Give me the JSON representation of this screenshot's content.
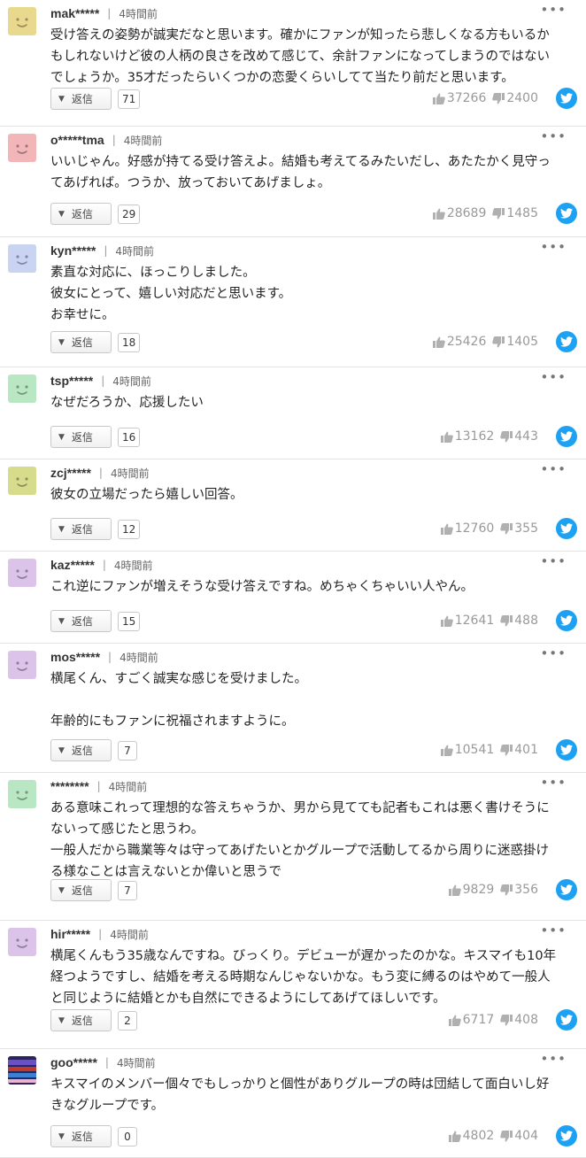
{
  "labels": {
    "reply": "返信",
    "more": "•••"
  },
  "colors": {
    "twitter": "#1da1f2",
    "vote_text": "#999999"
  },
  "comments": [
    {
      "user": "mak*****",
      "time": "4時間前",
      "avatar_color": "#e9d98f",
      "text": "受け答えの姿勢が誠実だなと思います。確かにファンが知ったら悲しくなる方もいるか\nもしれないけど彼の人柄の良さを改めて感じて、余計ファンになってしまうのではない\nでしょうか。35才だったらいくつかの恋愛くらいしてて当たり前だと思います。",
      "replies": "71",
      "likes": "37266",
      "dislikes": "2400"
    },
    {
      "user": "o*****tma",
      "time": "4時間前",
      "avatar_color": "#f2b5b8",
      "text": "いいじゃん。好感が持てる受け答えよ。結婚も考えてるみたいだし、あたたかく見守っ\nてあげれば。つうか、放っておいてあげましょ。",
      "replies": "29",
      "likes": "28689",
      "dislikes": "1485"
    },
    {
      "user": "kyn*****",
      "time": "4時間前",
      "avatar_color": "#c9d4f2",
      "text": "素直な対応に、ほっこりしました。\n彼女にとって、嬉しい対応だと思います。\nお幸せに。",
      "replies": "18",
      "likes": "25426",
      "dislikes": "1405"
    },
    {
      "user": "tsp*****",
      "time": "4時間前",
      "avatar_color": "#b9e6c3",
      "text": "なぜだろうか、応援したい",
      "replies": "16",
      "likes": "13162",
      "dislikes": "443"
    },
    {
      "user": "zcj*****",
      "time": "4時間前",
      "avatar_color": "#d6dc8c",
      "text": "彼女の立場だったら嬉しい回答。",
      "replies": "12",
      "likes": "12760",
      "dislikes": "355"
    },
    {
      "user": "kaz*****",
      "time": "4時間前",
      "avatar_color": "#dcc3ea",
      "text": "これ逆にファンが増えそうな受け答えですね。めちゃくちゃいい人やん。",
      "replies": "15",
      "likes": "12641",
      "dislikes": "488"
    },
    {
      "user": "mos*****",
      "time": "4時間前",
      "avatar_color": "#dcc3ea",
      "text": "横尾くん、すごく誠実な感じを受けました。\n\n年齢的にもファンに祝福されますように。",
      "replies": "7",
      "likes": "10541",
      "dislikes": "401"
    },
    {
      "user": "********",
      "time": "4時間前",
      "avatar_color": "#b9e6c3",
      "text": "ある意味これって理想的な答えちゃうか、男から見てても記者もこれは悪く書けそうに\nないって感じたと思うわ。\n一般人だから職業等々は守ってあげたいとかグループで活動してるから周りに迷惑掛け\nる様なことは言えないとか偉いと思うで",
      "replies": "7",
      "likes": "9829",
      "dislikes": "356"
    },
    {
      "user": "hir*****",
      "time": "4時間前",
      "avatar_color": "#dcc3ea",
      "text": "横尾くんもう35歳なんですね。びっくり。デビューが遅かったのかな。キスマイも10年\n経つようですし、結婚を考える時期なんじゃないかな。もう変に縛るのはやめて一般人\nと同じように結婚とかも自然にできるようにしてあげてほしいです。",
      "replies": "2",
      "likes": "6717",
      "dislikes": "408"
    },
    {
      "user": "goo*****",
      "time": "4時間前",
      "avatar_color": "#4a3a8c",
      "text": "キスマイのメンバー個々でもしっかりと個性がありグループの時は団結して面白いし好\nきなグループです。",
      "replies": "0",
      "likes": "4802",
      "dislikes": "404"
    }
  ]
}
